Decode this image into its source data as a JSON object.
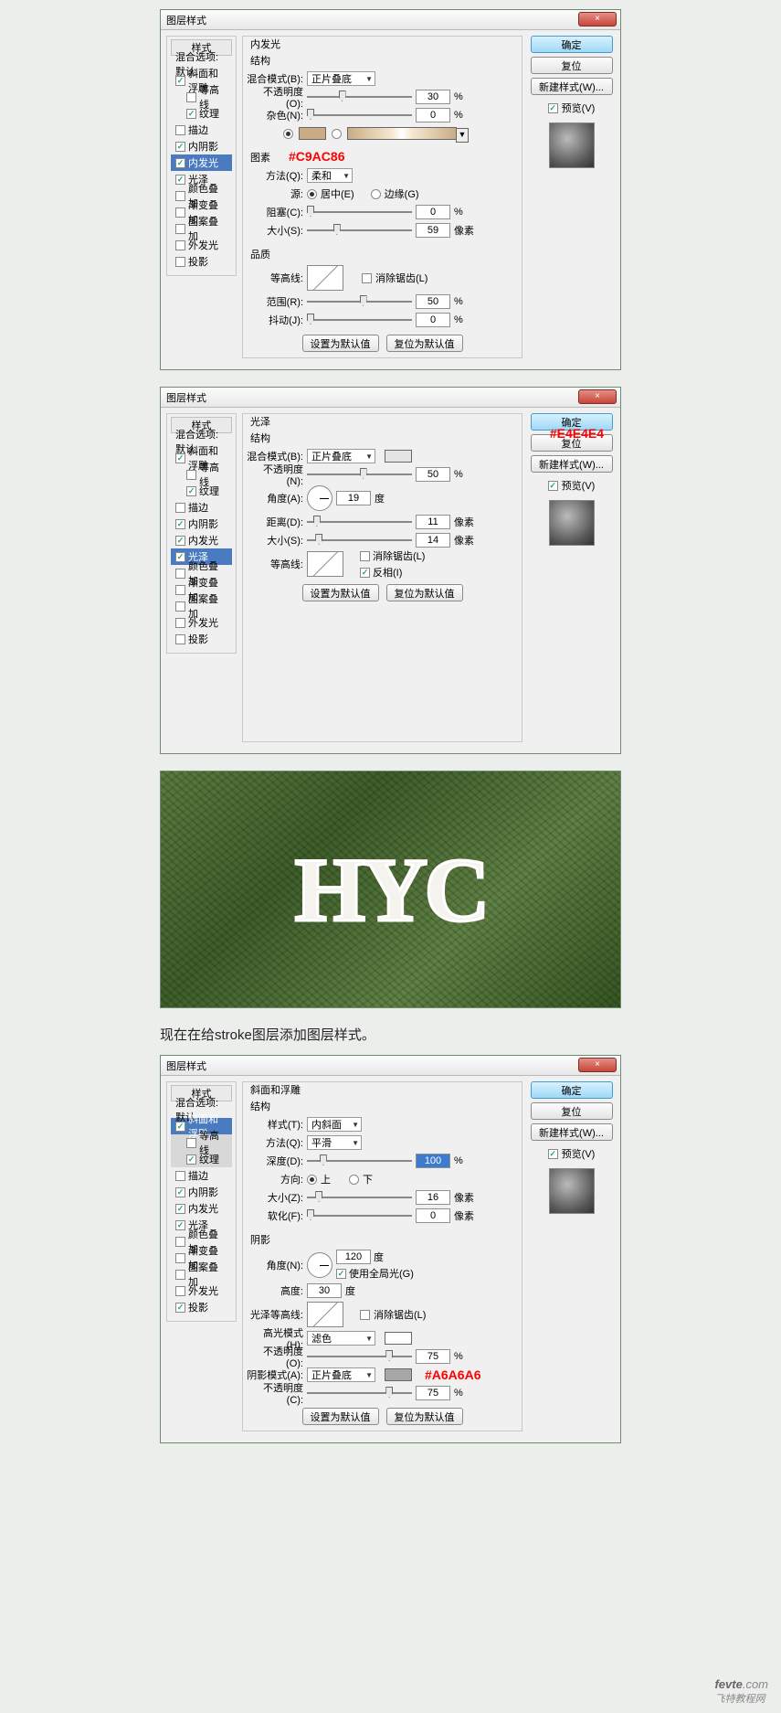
{
  "common": {
    "dialog_title": "图层样式",
    "close_x": "×",
    "ok": "确定",
    "reset": "复位",
    "new_style": "新建样式(W)...",
    "preview": "预览(V)",
    "styles_header": "样式",
    "blend_opts": "混合选项:默认",
    "set_default": "设置为默认值",
    "reset_default": "复位为默认值",
    "pct": "%",
    "px": "像素",
    "deg": "度"
  },
  "styles": {
    "bevel": "斜面和浮雕",
    "contour_sub": "等高线",
    "texture_sub": "纹理",
    "stroke": "描边",
    "inner_shadow": "内阴影",
    "inner_glow": "内发光",
    "satin": "光泽",
    "color_overlay": "颜色叠加",
    "grad_overlay": "渐变叠加",
    "pattern_overlay": "图案叠加",
    "outer_glow": "外发光",
    "drop_shadow": "投影"
  },
  "d1": {
    "section": "内发光",
    "structure": "结构",
    "blend_mode_l": "混合模式(B):",
    "blend_mode_v": "正片叠底",
    "opacity_l": "不透明度(O):",
    "opacity_v": "30",
    "noise_l": "杂色(N):",
    "noise_v": "0",
    "annot": "#C9AC86",
    "elements": "图素",
    "method_l": "方法(Q):",
    "method_v": "柔和",
    "source_l": "源:",
    "source_center": "居中(E)",
    "source_edge": "边缘(G)",
    "choke_l": "阻塞(C):",
    "choke_v": "0",
    "size_l": "大小(S):",
    "size_v": "59",
    "quality": "品质",
    "contour_l": "等高线:",
    "antialias": "消除锯齿(L)",
    "range_l": "范围(R):",
    "range_v": "50",
    "jitter_l": "抖动(J):",
    "jitter_v": "0"
  },
  "d2": {
    "section": "光泽",
    "structure": "结构",
    "blend_mode_l": "混合模式(B):",
    "blend_mode_v": "正片叠底",
    "opacity_l": "不透明度(N):",
    "opacity_v": "50",
    "angle_l": "角度(A):",
    "angle_v": "19",
    "distance_l": "距离(D):",
    "distance_v": "11",
    "size_l": "大小(S):",
    "size_v": "14",
    "contour_l": "等高线:",
    "antialias": "消除锯齿(L)",
    "invert": "反相(I)",
    "annot": "#E4E4E4"
  },
  "hyc": "HYC",
  "caption": "现在在给stroke图层添加图层样式。",
  "d3": {
    "section": "斜面和浮雕",
    "structure": "结构",
    "style_l": "样式(T):",
    "style_v": "内斜面",
    "method_l": "方法(Q):",
    "method_v": "平滑",
    "depth_l": "深度(D):",
    "depth_v": "100",
    "direction_l": "方向:",
    "dir_up": "上",
    "dir_down": "下",
    "size_l": "大小(Z):",
    "size_v": "16",
    "soften_l": "软化(F):",
    "soften_v": "0",
    "shading": "阴影",
    "angle_l": "角度(N):",
    "angle_v": "120",
    "global": "使用全局光(G)",
    "altitude_l": "高度:",
    "altitude_v": "30",
    "gloss_l": "光泽等高线:",
    "antialias": "消除锯齿(L)",
    "highlight_mode_l": "高光模式(H):",
    "highlight_mode_v": "滤色",
    "highlight_op_l": "不透明度(O):",
    "highlight_op_v": "75",
    "shadow_mode_l": "阴影模式(A):",
    "shadow_mode_v": "正片叠底",
    "shadow_op_l": "不透明度(C):",
    "shadow_op_v": "75",
    "annot": "#A6A6A6"
  },
  "watermark": {
    "main": "fevte",
    "suffix": ".com",
    "sub": "飞特教程网"
  }
}
